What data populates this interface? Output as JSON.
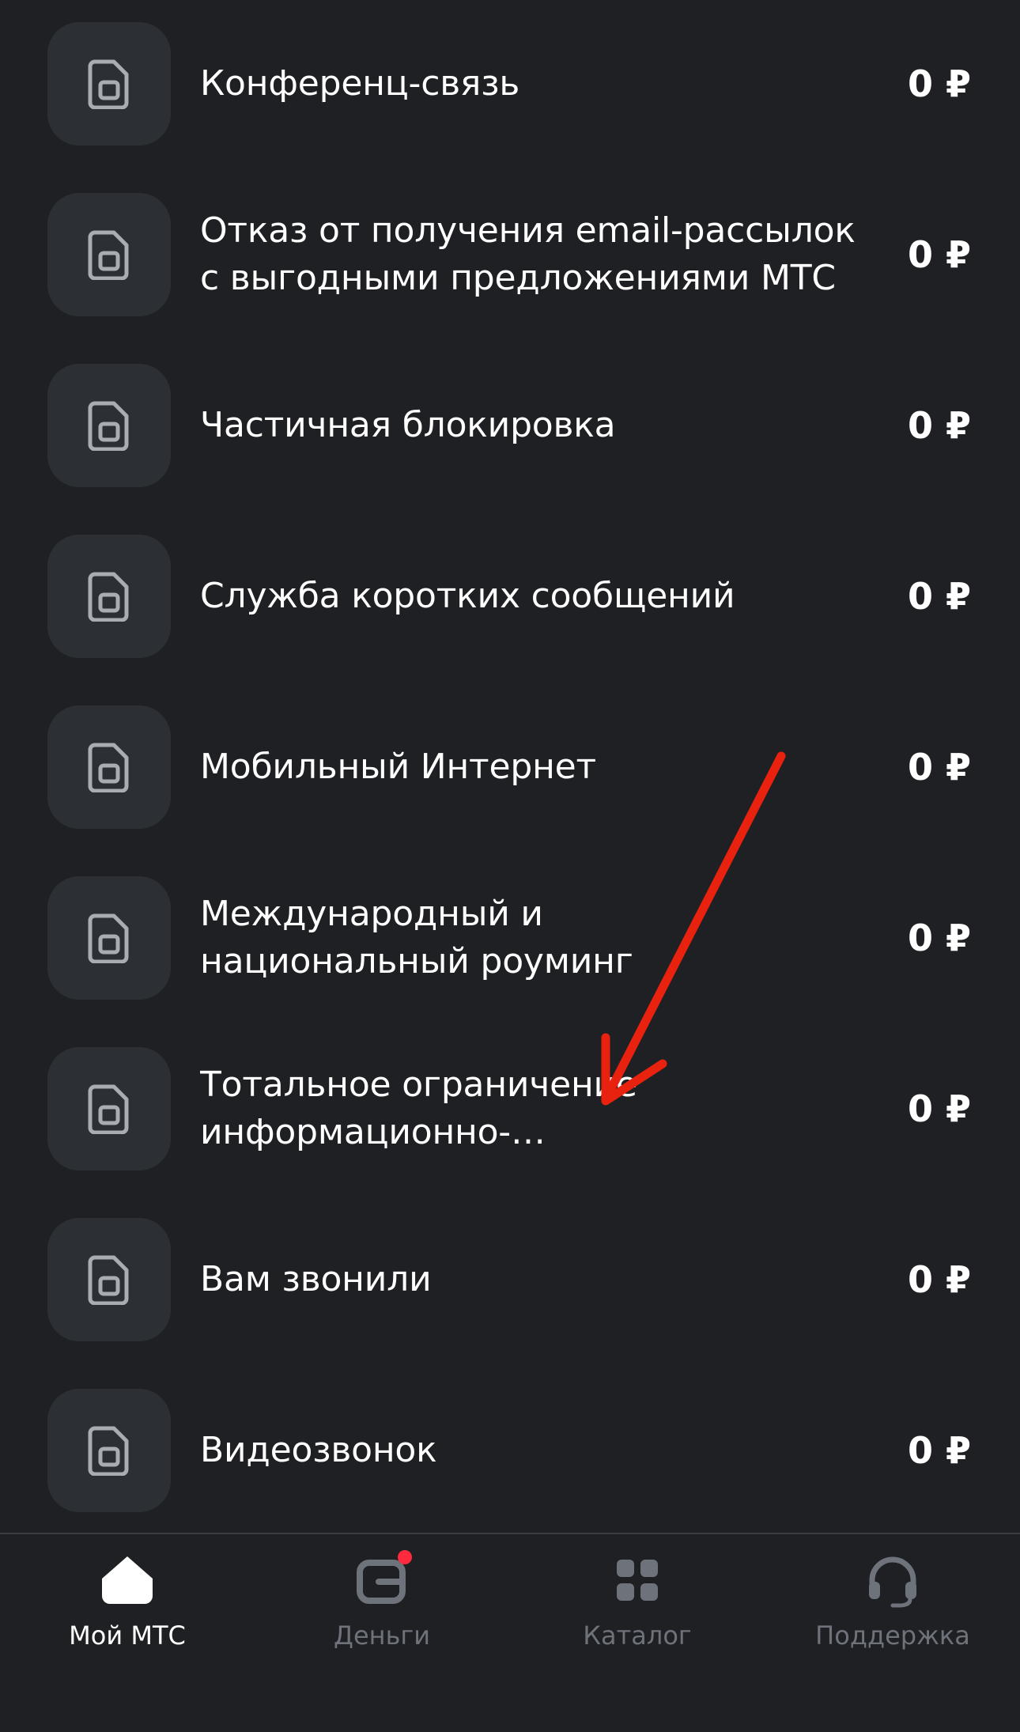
{
  "services": [
    {
      "title": "Конференц-связь",
      "price": "0 ₽"
    },
    {
      "title": "Отказ от получения email-рассылок с выгодными предложениями МТС",
      "price": "0 ₽"
    },
    {
      "title": "Частичная блокировка",
      "price": "0 ₽"
    },
    {
      "title": "Служба коротких сообщений",
      "price": "0 ₽"
    },
    {
      "title": "Мобильный Интернет",
      "price": "0 ₽"
    },
    {
      "title": "Международный и национальный роуминг",
      "price": "0 ₽"
    },
    {
      "title": "Тотальное ограничение информационно-развлекательных…",
      "price": "0 ₽"
    },
    {
      "title": "Вам звонили",
      "price": "0 ₽"
    },
    {
      "title": "Видеозвонок",
      "price": "0 ₽"
    }
  ],
  "tabbar": {
    "tabs": [
      {
        "label": "Мой МТС",
        "icon": "home-icon",
        "active": true
      },
      {
        "label": "Деньги",
        "icon": "wallet-icon",
        "badge": true
      },
      {
        "label": "Каталог",
        "icon": "grid-icon"
      },
      {
        "label": "Поддержка",
        "icon": "headset-icon"
      }
    ]
  },
  "colors": {
    "background": "#1f2023",
    "tile": "#2c2f33",
    "annotation_arrow": "#e8220f",
    "badge": "#ff2a3d",
    "tab_inactive": "#6e727a"
  }
}
